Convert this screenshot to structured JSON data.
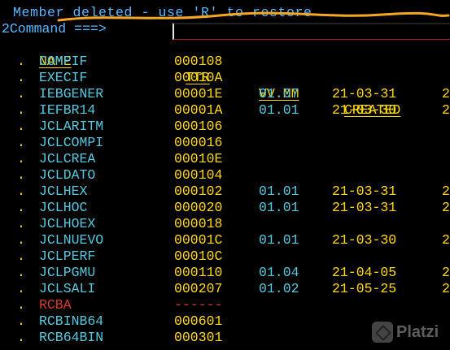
{
  "message": "Member deleted - use 'R' to restore",
  "command": {
    "label": "2Command ===>",
    "value": ""
  },
  "columns": {
    "name": "NAME",
    "ttr": "TTR",
    "vv": "VV.MM",
    "created": "CREATED"
  },
  "members": [
    {
      "sel": ".",
      "name": "COMPIF",
      "ttr": "000108",
      "vv": "",
      "created": "",
      "extra": ""
    },
    {
      "sel": ".",
      "name": "EXECIF",
      "ttr": "00010A",
      "vv": "",
      "created": "",
      "extra": ""
    },
    {
      "sel": ".",
      "name": "IEBGENER",
      "ttr": "00001E",
      "vv": "01.07",
      "created": "21-03-31",
      "extra": "2"
    },
    {
      "sel": ".",
      "name": "IEFBR14",
      "ttr": "00001A",
      "vv": "01.01",
      "created": "21-03-30",
      "extra": "2"
    },
    {
      "sel": ".",
      "name": "JCLARITM",
      "ttr": "000106",
      "vv": "",
      "created": "",
      "extra": ""
    },
    {
      "sel": ".",
      "name": "JCLCOMPI",
      "ttr": "000016",
      "vv": "",
      "created": "",
      "extra": ""
    },
    {
      "sel": ".",
      "name": "JCLCREA",
      "ttr": "00010E",
      "vv": "",
      "created": "",
      "extra": ""
    },
    {
      "sel": ".",
      "name": "JCLDATO",
      "ttr": "000104",
      "vv": "",
      "created": "",
      "extra": ""
    },
    {
      "sel": ".",
      "name": "JCLHEX",
      "ttr": "000102",
      "vv": "01.01",
      "created": "21-03-31",
      "extra": "2"
    },
    {
      "sel": ".",
      "name": "JCLHOC",
      "ttr": "000020",
      "vv": "01.01",
      "created": "21-03-31",
      "extra": "2"
    },
    {
      "sel": ".",
      "name": "JCLHOEX",
      "ttr": "000018",
      "vv": "",
      "created": "",
      "extra": ""
    },
    {
      "sel": ".",
      "name": "JCLNUEVO",
      "ttr": "00001C",
      "vv": "01.01",
      "created": "21-03-30",
      "extra": "2"
    },
    {
      "sel": ".",
      "name": "JCLPERF",
      "ttr": "00010C",
      "vv": "",
      "created": "",
      "extra": ""
    },
    {
      "sel": ".",
      "name": "JCLPGMU",
      "ttr": "000110",
      "vv": "01.04",
      "created": "21-04-05",
      "extra": "2"
    },
    {
      "sel": ".",
      "name": "JCLSALI",
      "ttr": "000207",
      "vv": "01.02",
      "created": "21-05-25",
      "extra": "2"
    },
    {
      "sel": ".",
      "name": "RCBA",
      "ttr": "------",
      "vv": "",
      "created": "",
      "extra": "",
      "deleted": true
    },
    {
      "sel": ".",
      "name": "RCBINB64",
      "ttr": "000601",
      "vv": "",
      "created": "",
      "extra": ""
    },
    {
      "sel": ".",
      "name": "RCB64BIN",
      "ttr": "000301",
      "vv": "",
      "created": "",
      "extra": ""
    }
  ],
  "watermark": {
    "text": "Platzi",
    "icon": "platzi-logo-icon"
  },
  "colors": {
    "background": "#000000",
    "message": "#59b7ff",
    "turquoise": "#56c8de",
    "yellow": "#ffd900",
    "deleted": "#d23a2a",
    "annotation": "#f5a623"
  }
}
